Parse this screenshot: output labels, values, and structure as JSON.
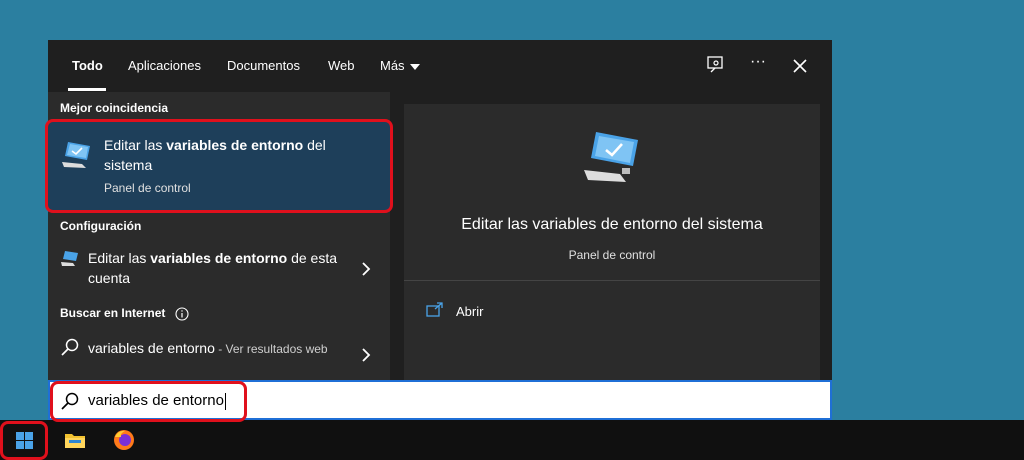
{
  "tabs": [
    {
      "label": "Todo"
    },
    {
      "label": "Aplicaciones"
    },
    {
      "label": "Documentos"
    },
    {
      "label": "Web"
    },
    {
      "label": "Más"
    }
  ],
  "toolbar": {
    "feedback_icon": "feedback-icon",
    "more_icon": "more-options-icon",
    "close_icon": "close-icon",
    "more_dots": "···"
  },
  "best_match": {
    "section_label": "Mejor coincidencia",
    "title_pre": "Editar las ",
    "title_bold": "variables de entorno",
    "title_post": " del sistema",
    "subtitle": "Panel de control"
  },
  "settings": {
    "section_label": "Configuración",
    "item_pre": "Editar las ",
    "item_bold": "variables de entorno",
    "item_post": " de esta cuenta"
  },
  "web": {
    "section_label": "Buscar en Internet",
    "query": "variables de entorno",
    "suffix": " - Ver resultados web"
  },
  "preview": {
    "title": "Editar las variables de entorno del sistema",
    "subtitle": "Panel de control",
    "open_label": "Abrir"
  },
  "search": {
    "value": "variables de entorno"
  },
  "taskbar": {
    "items": [
      "start-button",
      "file-explorer",
      "firefox"
    ]
  },
  "colors": {
    "desktop": "#2b7fa0",
    "panel": "#1f1f1f",
    "highlight": "#1e3f5a",
    "annotation": "#e0101c"
  }
}
